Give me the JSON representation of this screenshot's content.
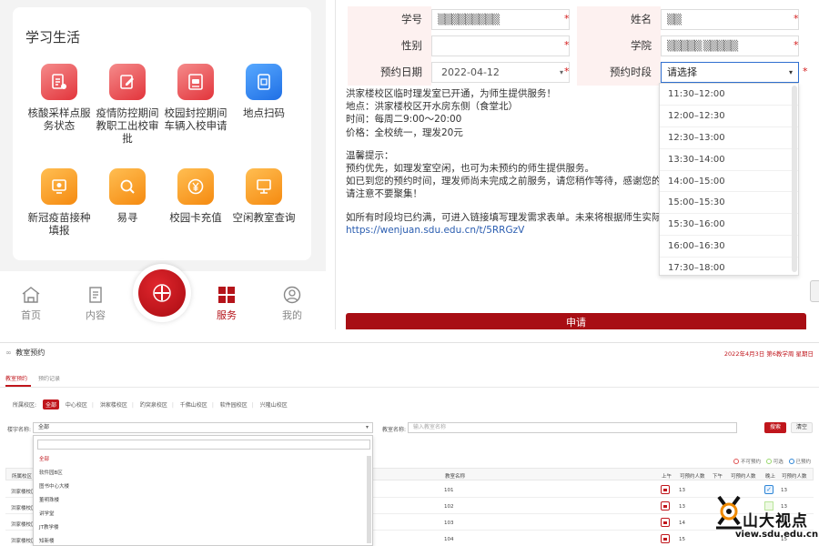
{
  "phone": {
    "section_title": "学习生活",
    "services": [
      {
        "label": "核酸采样点服务状态",
        "icon": "test-tube-icon",
        "color": "red"
      },
      {
        "label": "疫情防控期间教职工出校审批",
        "icon": "edit-form-icon",
        "color": "red"
      },
      {
        "label": "校园封控期间车辆入校申请",
        "icon": "car-form-icon",
        "color": "red"
      },
      {
        "label": "地点扫码",
        "icon": "scan-icon",
        "color": "blue"
      },
      {
        "label": "新冠疫苗接种填报",
        "icon": "vaccine-icon",
        "color": "orange"
      },
      {
        "label": "易寻",
        "icon": "search-icon",
        "color": "orange"
      },
      {
        "label": "校园卡充值",
        "icon": "yen-coin-icon",
        "color": "orange"
      },
      {
        "label": "空闲教室查询",
        "icon": "classroom-icon",
        "color": "orange"
      }
    ],
    "tabs": [
      {
        "label": "首页",
        "icon": "home-icon",
        "active": false
      },
      {
        "label": "内容",
        "icon": "document-icon",
        "active": false
      },
      {
        "label": "服务",
        "icon": "grid-icon",
        "active": true
      },
      {
        "label": "我的",
        "icon": "user-icon",
        "active": false
      }
    ],
    "accent": "#b5141a"
  },
  "form": {
    "student_id_label": "学号",
    "student_id_value": "▒▒▒▒▒▒▒▒▒",
    "name_label": "姓名",
    "name_value": "▒▒",
    "gender_label": "性别",
    "gender_value": "",
    "college_label": "学院",
    "college_value": "▒▒▒▒▒ ▒▒▒▒▒",
    "date_label": "预约日期",
    "date_value": "2022-04-12",
    "slot_label": "预约时段",
    "slot_placeholder": "请选择",
    "slot_options": [
      "11:30–12:00",
      "12:00–12:30",
      "12:30–13:00",
      "13:30–14:00",
      "14:00–15:00",
      "15:00–15:30",
      "15:30–16:00",
      "16:00–16:30",
      "17:30–18:00"
    ],
    "notice_lines": [
      "洪家楼校区临时理发室已开通，为师生提供服务！",
      "地点：洪家楼校区开水房东侧（食堂北）",
      "时间：每周二9:00～20:00",
      "价格：全校统一，理发20元",
      "",
      "温馨提示：",
      "预约优先，如理发室空闲，也可为未预约的师生提供服务。",
      "如已到您的预约时间，理发师尚未完成之前服务，请您稍作等待，感谢您的理解。",
      "请注意不要聚集！",
      "",
      "如所有时段均已约满，可进入链接填写理发需求表单。未来将根据师生实际需求量，尽"
    ],
    "notice_link": "https://wenjuan.sdu.edu.cn/t/5RRGzV",
    "submit_label": "申请",
    "accent": "#a80e14"
  },
  "desk": {
    "title": "教室预约",
    "date_info": "2022年4月3日 第6教学周 星期日",
    "tabs": [
      {
        "label": "教室预约",
        "active": true
      },
      {
        "label": "预约记录",
        "active": false
      }
    ],
    "campus_label": "所属校区:",
    "campuses": [
      "全部",
      "中心校区",
      "洪家楼校区",
      "趵突泉校区",
      "千佛山校区",
      "软件园校区",
      "兴隆山校区"
    ],
    "building_label": "楼宇名称:",
    "building_value": "全部",
    "room_label": "教室名称:",
    "room_placeholder": "输入教室名称",
    "search_btn": "搜索",
    "clear_btn": "清空",
    "building_options": [
      "全部",
      "软件园B区",
      "图书中心大楼",
      "董明珠楼",
      "讲学堂",
      "JT教学楼",
      "知新楼"
    ],
    "legend": [
      {
        "label": "不可预约",
        "color": "#e05555"
      },
      {
        "label": "可选",
        "color": "#9ad96f"
      },
      {
        "label": "已预约",
        "color": "#2f86d6"
      }
    ],
    "columns": [
      "所属校区",
      "教室名称",
      "上午",
      "可预约人数",
      "下午",
      "可预约人数",
      "晚上",
      "可预约人数"
    ],
    "rows": [
      {
        "campus": "洪家楼校区",
        "room": "101",
        "am": "13",
        "pm": "11",
        "eve": "13"
      },
      {
        "campus": "洪家楼校区",
        "room": "102",
        "am": "13",
        "pm": "",
        "eve": "13"
      },
      {
        "campus": "洪家楼校区",
        "room": "103",
        "am": "14",
        "pm": "",
        "eve": "14"
      },
      {
        "campus": "洪家楼校区",
        "room": "104",
        "am": "15",
        "pm": "",
        "eve": "15"
      }
    ],
    "watermark": {
      "text": "山大视点",
      "url": "view.sdu.edu.cn"
    }
  }
}
